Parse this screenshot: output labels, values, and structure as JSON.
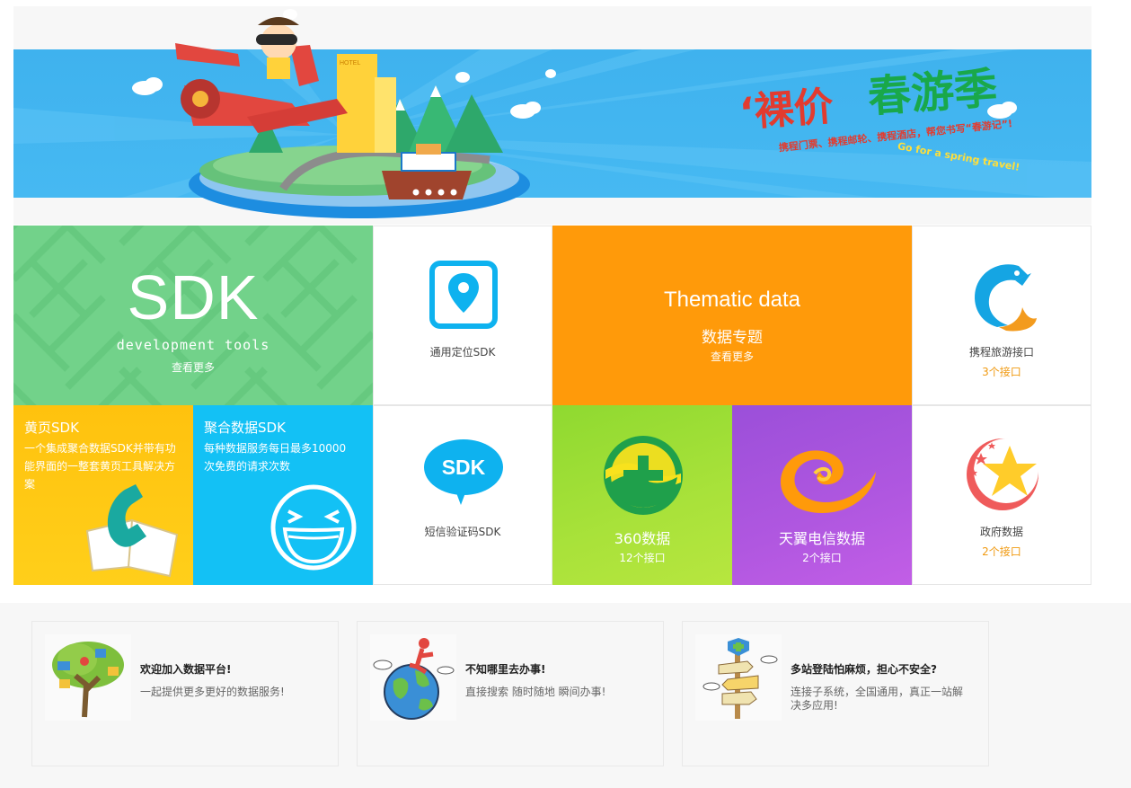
{
  "banner": {
    "hotel_sign": "HOTEL"
  },
  "tiles": {
    "sdk": {
      "title": "SDK",
      "subtitle": "development tools",
      "more": "查看更多"
    },
    "location": {
      "label": "通用定位SDK"
    },
    "thematic": {
      "title": "Thematic data",
      "subtitle": "数据专题",
      "more": "查看更多"
    },
    "ctrip": {
      "label": "携程旅游接口",
      "count": "3个接口"
    },
    "yellow_pages": {
      "title": "黄页SDK",
      "description": "一个集成聚合数据SDK并带有功能界面的一整套黄页工具解决方案"
    },
    "juhe": {
      "title": "聚合数据SDK",
      "description": "每种数据服务每日最多10000次免费的请求次数"
    },
    "sms": {
      "label": "短信验证码SDK",
      "icon_text": "SDK"
    },
    "data360": {
      "label": "360数据",
      "count": "12个接口"
    },
    "tianyi": {
      "label": "天翼电信数据",
      "count": "2个接口"
    },
    "gov": {
      "label": "政府数据",
      "count": "2个接口"
    }
  },
  "features": [
    {
      "title": "欢迎加入数据平台!",
      "description": "一起提供更多更好的数据服务!"
    },
    {
      "title": "不知哪里去办事!",
      "description": "直接搜索 随时随地 瞬间办事!"
    },
    {
      "title": "多站登陆怕麻烦，担心不安全?",
      "description": "连接子系统，全国通用，真正一站解决多应用!"
    }
  ],
  "colors": {
    "banner_blue": "#3fb2ee",
    "sdk_green": "#72d28a",
    "thematic_orange": "#ff9a0a",
    "juhe_blue": "#13c1f5",
    "yellow": "#ffc20e",
    "green_360": "#9bdd34",
    "purple": "#b057e0",
    "count_orange": "#f09a12"
  }
}
